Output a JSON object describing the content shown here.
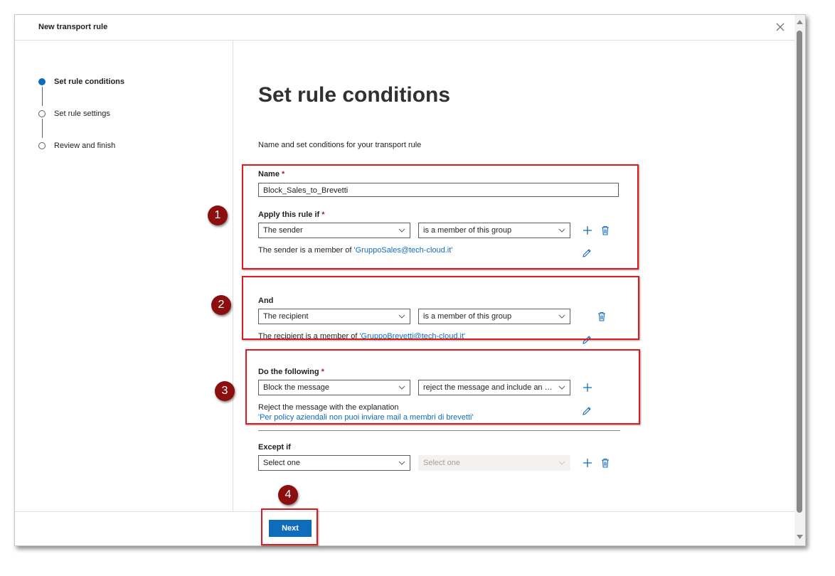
{
  "dialog": {
    "title": "New transport rule"
  },
  "steps": [
    {
      "label": "Set rule conditions",
      "state": "active"
    },
    {
      "label": "Set rule settings",
      "state": "inactive"
    },
    {
      "label": "Review and finish",
      "state": "inactive"
    }
  ],
  "page": {
    "heading": "Set rule conditions",
    "subtitle": "Name and set conditions for your transport rule"
  },
  "name_field": {
    "label": "Name",
    "required_mark": "*",
    "value": "Block_Sales_to_Brevetti"
  },
  "apply_if": {
    "label": "Apply this rule if",
    "required_mark": "*",
    "condition": "The sender",
    "operator": "is a member of this group",
    "description_prefix": "The sender is a member of",
    "description_value": "'GruppoSales@tech-cloud.it'"
  },
  "and_clause": {
    "label": "And",
    "condition": "The recipient",
    "operator": "is a member of this group",
    "description_prefix": "The recipient is a member of",
    "description_value": "'GruppoBrevetti@tech-cloud.it'"
  },
  "do_following": {
    "label": "Do the following",
    "required_mark": "*",
    "action": "Block the message",
    "option": "reject the message and include an ex...",
    "description_prefix": "Reject the message with the explanation",
    "description_value": "'Per policy aziendali non puoi inviare mail a membri di brevetti'"
  },
  "except_if": {
    "label": "Except if",
    "condition": "Select one",
    "operator": "Select one"
  },
  "footer": {
    "next_label": "Next"
  },
  "annotations": [
    "1",
    "2",
    "3",
    "4"
  ],
  "colors": {
    "accent": "#0f6cbd",
    "annotation_border": "#e0191a",
    "annotation_badge": "#8b0f0f"
  }
}
